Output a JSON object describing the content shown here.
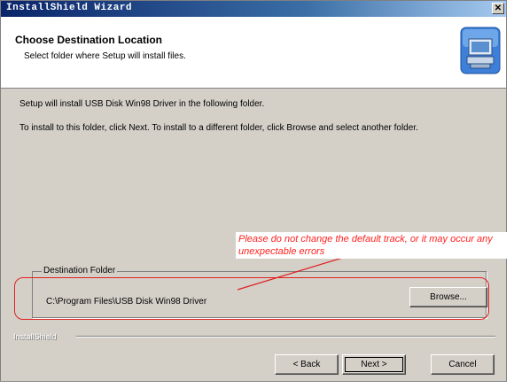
{
  "window": {
    "title": "InstallShield Wizard",
    "close_glyph": "✕"
  },
  "header": {
    "title": "Choose Destination Location",
    "subtitle": "Select folder where Setup will install files.",
    "icon": "install-computer-icon"
  },
  "body": {
    "line1": "Setup will install USB Disk Win98 Driver in the following folder.",
    "line2": "To install to this folder, click Next. To install to a different folder, click Browse and select another folder."
  },
  "destination": {
    "group_label": "Destination Folder",
    "path": "C:\\Program Files\\USB Disk Win98 Driver",
    "browse_label": "Browse..."
  },
  "footer": {
    "separator_label": "InstallShield",
    "back_label": "< Back",
    "next_label": "Next >",
    "cancel_label": "Cancel"
  },
  "annotation": {
    "text": "Please do not change the default track, or it may occur any unexpectable errors",
    "color": "#ff2020"
  },
  "colors": {
    "titlebar": "#0a246a",
    "dialog_face": "#d4d0c8"
  }
}
